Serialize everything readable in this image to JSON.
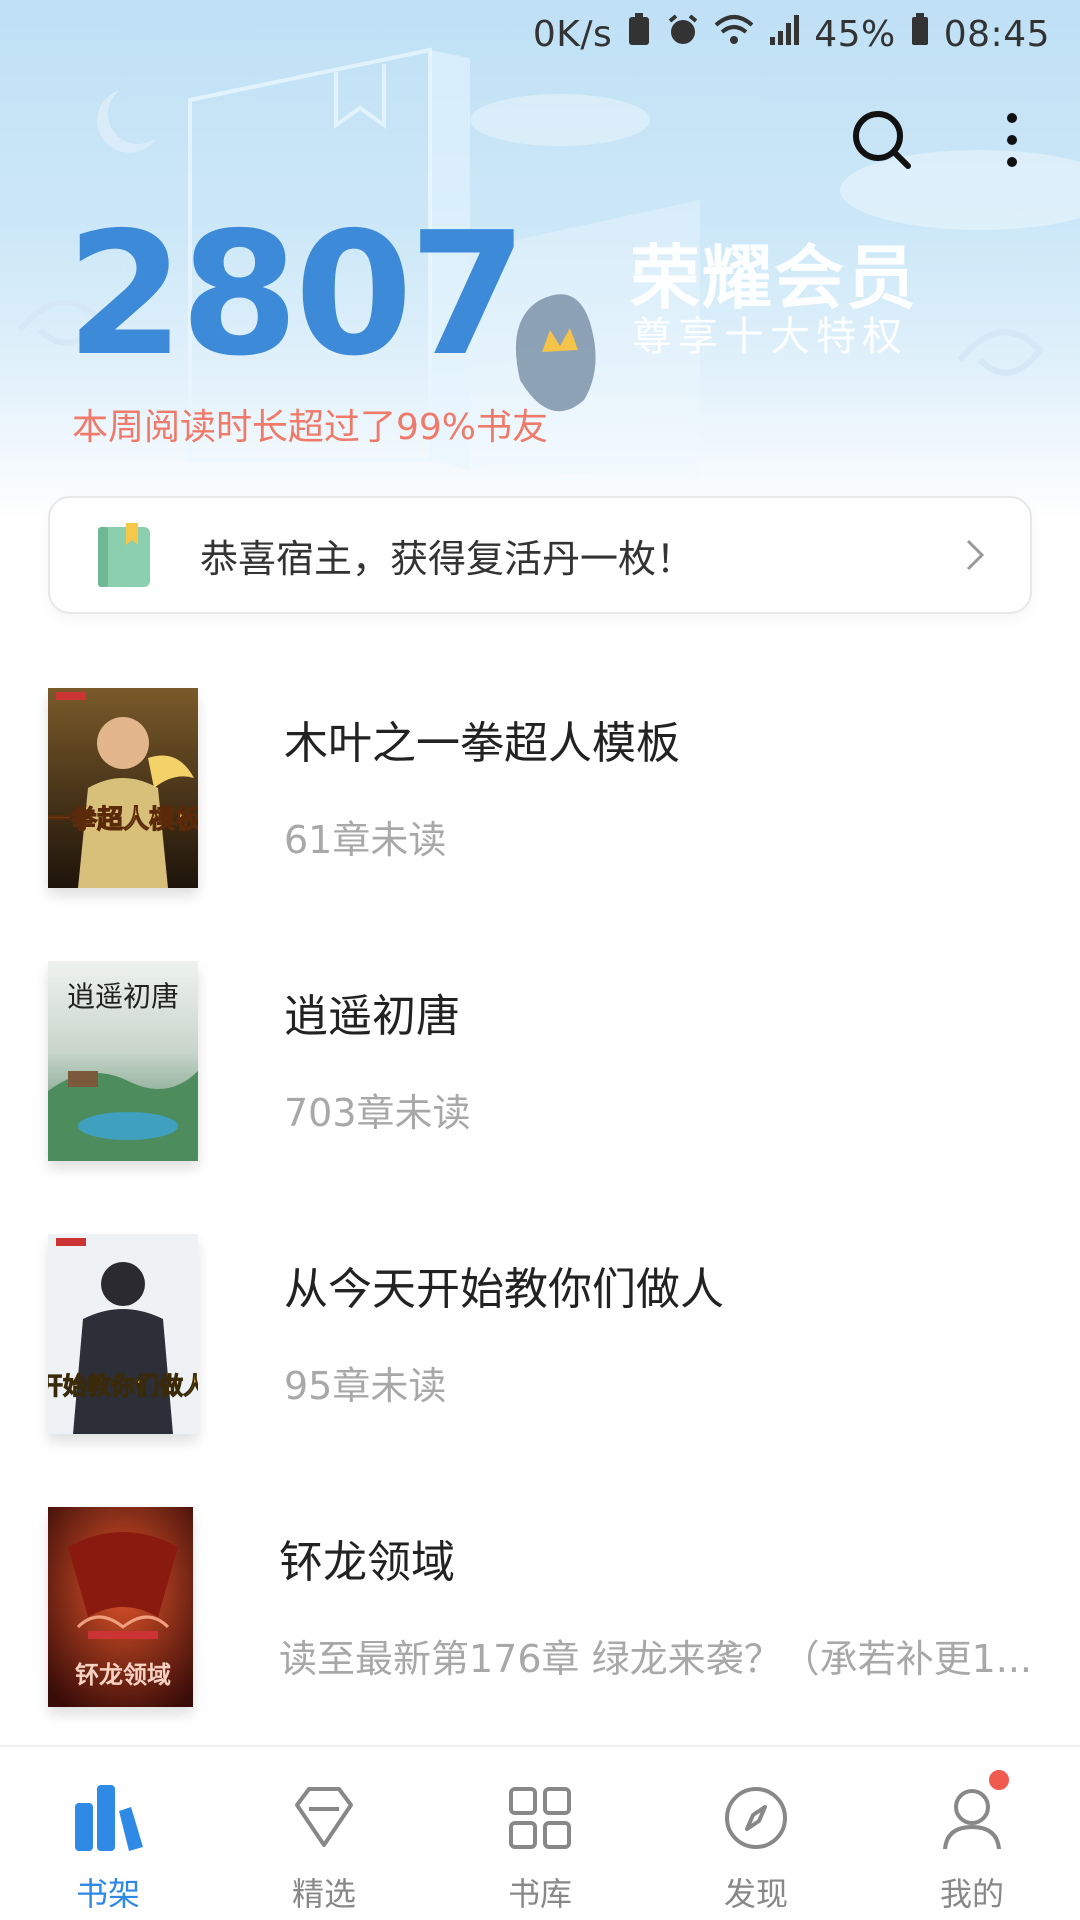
{
  "status_bar": {
    "speed": "0K/s",
    "battery": "45%",
    "time": "08:45"
  },
  "hero": {
    "reading_count": "2807",
    "reading_note": "本周阅读时长超过了99%书友",
    "vip_title": "荣耀会员",
    "vip_subtitle": "尊享十大特权"
  },
  "notice": {
    "text": "恭喜宿主，获得复活丹一枚！"
  },
  "books": [
    {
      "title": "木叶之一拳超人模板",
      "progress": "61章未读",
      "cover_color": "#3a2a1a",
      "cover_accent": "#f2c12e",
      "cover_text": "一拳超人模板"
    },
    {
      "title": "逍遥初唐",
      "progress": "703章未读",
      "cover_color": "#8fb3a0",
      "cover_accent": "#2e6b4a",
      "cover_text": "逍遥初唐"
    },
    {
      "title": "从今天开始教你们做人",
      "progress": "95章未读",
      "cover_color": "#e8eef2",
      "cover_accent": "#d9a81e",
      "cover_text": "开始教你们做人"
    },
    {
      "title": "钚龙领域",
      "progress": "读至最新第176章 绿龙来袭？（承若补更1...",
      "cover_color": "#5a1a12",
      "cover_accent": "#e04a2a",
      "cover_text": "钚龙领域"
    }
  ],
  "nav": [
    {
      "label": "书架",
      "icon": "bookshelf-icon",
      "active": true
    },
    {
      "label": "精选",
      "icon": "diamond-icon",
      "active": false
    },
    {
      "label": "书库",
      "icon": "grid-icon",
      "active": false
    },
    {
      "label": "发现",
      "icon": "compass-icon",
      "active": false
    },
    {
      "label": "我的",
      "icon": "user-icon",
      "active": false
    }
  ],
  "colors": {
    "accent": "#2f8ae5",
    "count": "#3d8ad8",
    "note": "#f07a6a",
    "badge": "#f05a4f"
  }
}
